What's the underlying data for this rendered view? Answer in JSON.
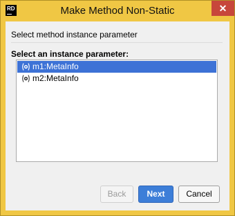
{
  "window": {
    "title": "Make Method Non-Static",
    "app_icon": {
      "text": "RD",
      "name": "rider-icon"
    },
    "close_glyph": "✕"
  },
  "dialog": {
    "instruction": "Select method instance parameter",
    "list_label": "Select an instance parameter:",
    "parameters": [
      {
        "label": "m1:MetaInfo",
        "selected": true,
        "icon": "parameter-icon"
      },
      {
        "label": "m2:MetaInfo",
        "selected": false,
        "icon": "parameter-icon"
      }
    ]
  },
  "buttons": {
    "back": {
      "label": "Back",
      "enabled": false
    },
    "next": {
      "label": "Next",
      "enabled": true,
      "default": true
    },
    "cancel": {
      "label": "Cancel",
      "enabled": true
    }
  },
  "colors": {
    "titlebar": "#f0c744",
    "close": "#c7473b",
    "selection": "#3d72d6",
    "primary_button": "#3d7ed8"
  }
}
